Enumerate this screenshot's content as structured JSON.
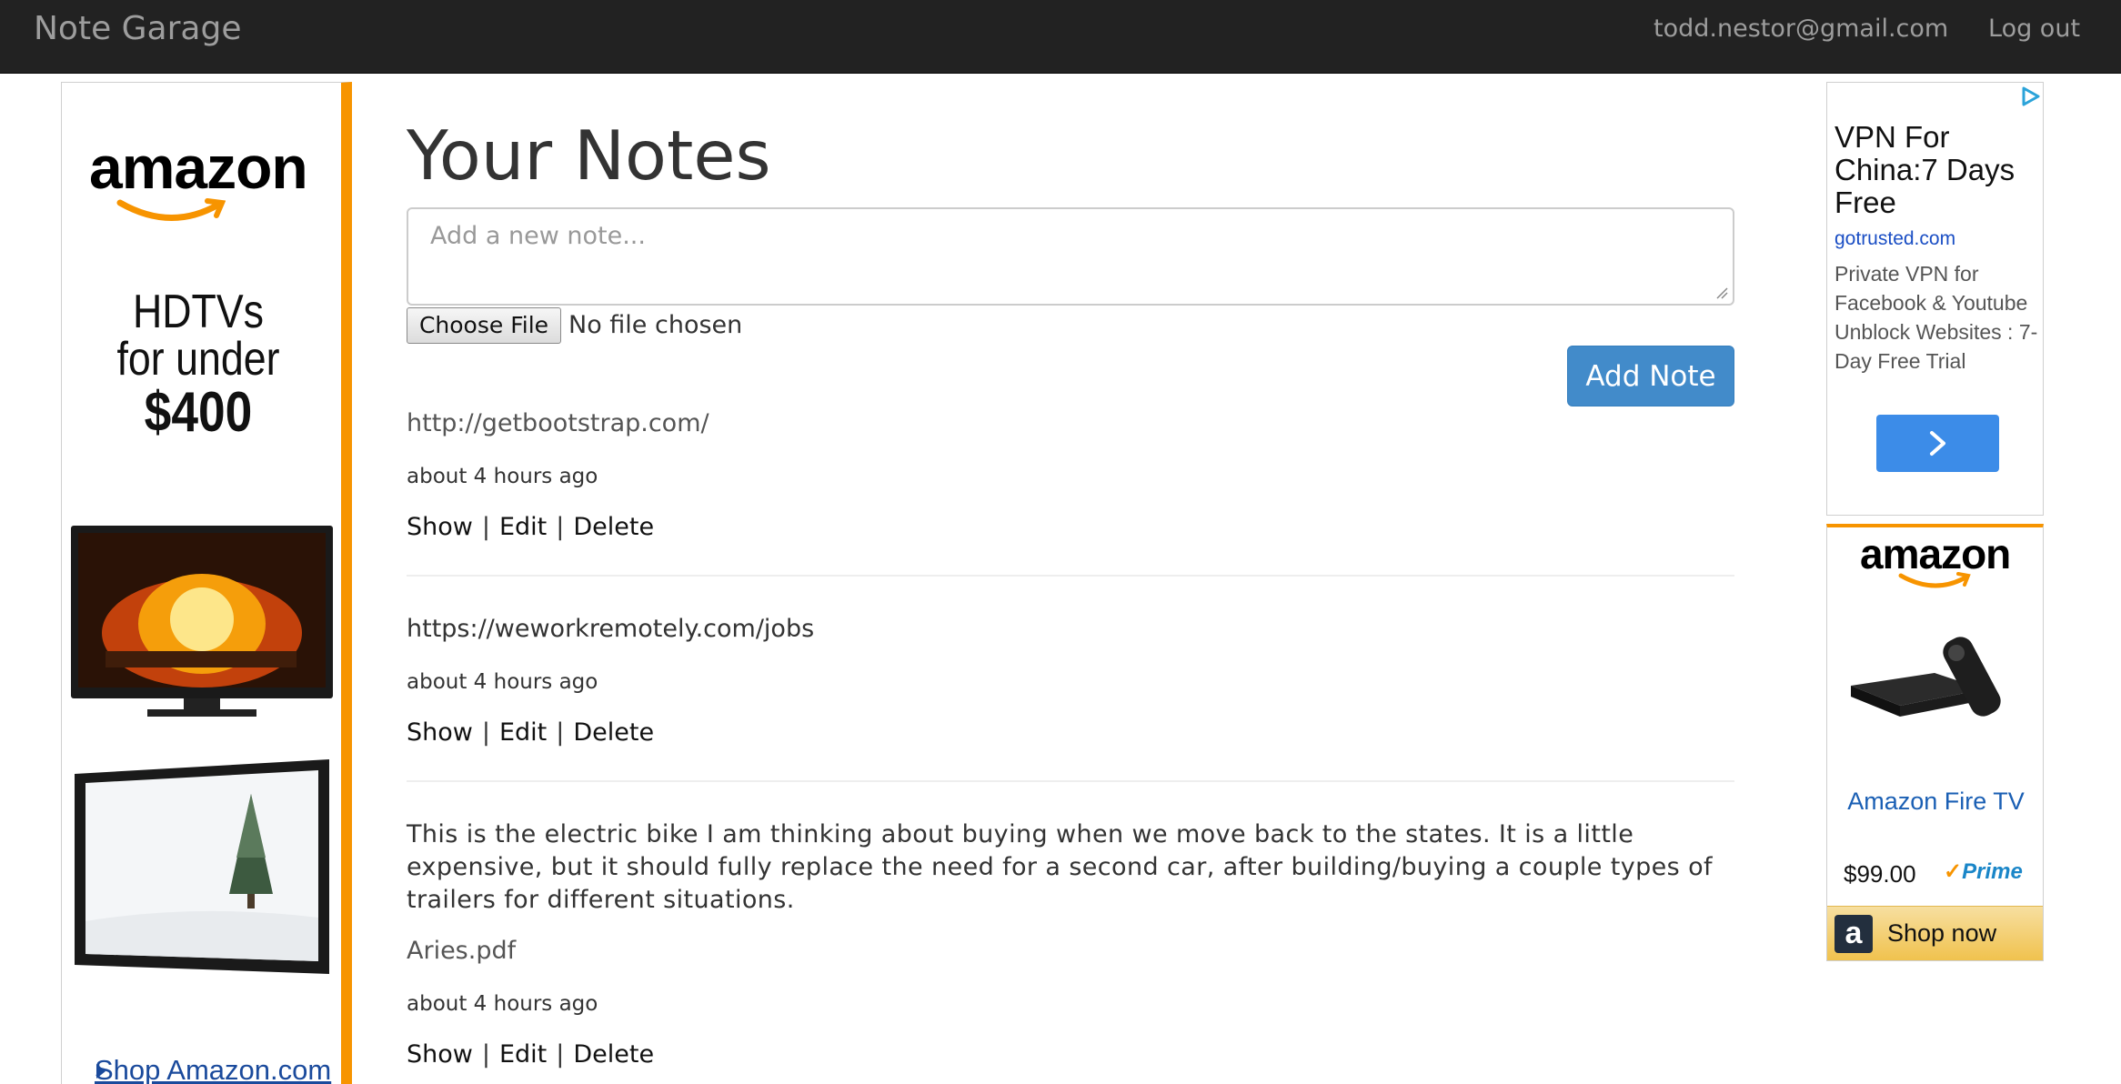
{
  "navbar": {
    "brand": "Note Garage",
    "user_email": "todd.nestor@gmail.com",
    "logout": "Log out"
  },
  "left_ad": {
    "logo": "amazon",
    "promo_line1": "HDTVs",
    "promo_line2": "for under",
    "promo_price": "$400",
    "shop_link": "Shop Amazon.com"
  },
  "main": {
    "title": "Your Notes",
    "note_placeholder": "Add a new note...",
    "file_button": "Choose File",
    "file_status": "No file chosen",
    "add_button": "Add Note",
    "notes": [
      {
        "text": "http://getbootstrap.com/",
        "time": "about 4 hours ago",
        "show": "Show",
        "edit": "Edit",
        "delete": "Delete"
      },
      {
        "text": "https://weworkremotely.com/jobs",
        "time": "about 4 hours ago",
        "show": "Show",
        "edit": "Edit",
        "delete": "Delete"
      },
      {
        "text": "This is the electric bike I am thinking about buying when we move back to the states. It is a little expensive, but it should fully replace the need for a second car, after building/buying a couple types of trailers for different situations.",
        "attachment": "Aries.pdf",
        "time": "about 4 hours ago",
        "show": "Show",
        "edit": "Edit",
        "delete": "Delete"
      }
    ],
    "separator": "|"
  },
  "right_ad_vpn": {
    "title": "VPN For China:7 Days Free",
    "domain": "gotrusted.com",
    "description": "Private VPN for Facebook & Youtube Unblock Websites : 7-Day Free Trial"
  },
  "right_ad_fire": {
    "logo": "amazon",
    "product": "Amazon Fire TV",
    "price": "$99.00",
    "prime": "Prime",
    "shop_now": "Shop now",
    "shop_now_icon_letter": "a"
  },
  "colors": {
    "navbar_bg": "#222222",
    "button_primary": "#428bca",
    "amazon_orange": "#f79400"
  }
}
